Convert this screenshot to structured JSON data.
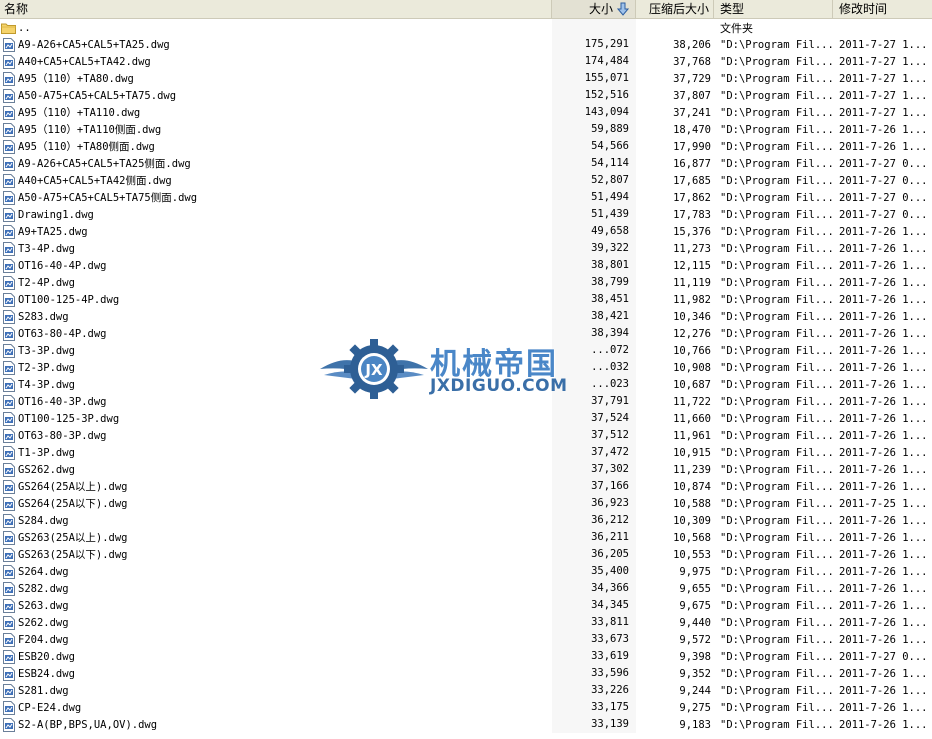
{
  "columns": {
    "name": "名称",
    "size": "大小",
    "compressed": "压缩后大小",
    "type": "类型",
    "modified": "修改时间"
  },
  "watermark": {
    "logo_letters": "JX",
    "cn": "机械帝国",
    "en": "JXDIGUO.COM"
  },
  "parent": {
    "name": "..",
    "type": "文件夹"
  },
  "files": [
    {
      "name": "A9-A26+CA5+CAL5+TA25.dwg",
      "size": "175,291",
      "comp": "38,206",
      "type": "\"D:\\Program Fil...",
      "time": "2011-7-27 1..."
    },
    {
      "name": "A40+CA5+CAL5+TA42.dwg",
      "size": "174,484",
      "comp": "37,768",
      "type": "\"D:\\Program Fil...",
      "time": "2011-7-27 1..."
    },
    {
      "name": "A95（110）+TA80.dwg",
      "size": "155,071",
      "comp": "37,729",
      "type": "\"D:\\Program Fil...",
      "time": "2011-7-27 1..."
    },
    {
      "name": "A50-A75+CA5+CAL5+TA75.dwg",
      "size": "152,516",
      "comp": "37,807",
      "type": "\"D:\\Program Fil...",
      "time": "2011-7-27 1..."
    },
    {
      "name": "A95（110）+TA110.dwg",
      "size": "143,094",
      "comp": "37,241",
      "type": "\"D:\\Program Fil...",
      "time": "2011-7-27 1..."
    },
    {
      "name": "A95（110）+TA110侧面.dwg",
      "size": "59,889",
      "comp": "18,470",
      "type": "\"D:\\Program Fil...",
      "time": "2011-7-26 1..."
    },
    {
      "name": "A95（110）+TA80侧面.dwg",
      "size": "54,566",
      "comp": "17,990",
      "type": "\"D:\\Program Fil...",
      "time": "2011-7-26 1..."
    },
    {
      "name": "A9-A26+CA5+CAL5+TA25侧面.dwg",
      "size": "54,114",
      "comp": "16,877",
      "type": "\"D:\\Program Fil...",
      "time": "2011-7-27 0..."
    },
    {
      "name": "A40+CA5+CAL5+TA42侧面.dwg",
      "size": "52,807",
      "comp": "17,685",
      "type": "\"D:\\Program Fil...",
      "time": "2011-7-27 0..."
    },
    {
      "name": "A50-A75+CA5+CAL5+TA75侧面.dwg",
      "size": "51,494",
      "comp": "17,862",
      "type": "\"D:\\Program Fil...",
      "time": "2011-7-27 0..."
    },
    {
      "name": "Drawing1.dwg",
      "size": "51,439",
      "comp": "17,783",
      "type": "\"D:\\Program Fil...",
      "time": "2011-7-27 0..."
    },
    {
      "name": "A9+TA25.dwg",
      "size": "49,658",
      "comp": "15,376",
      "type": "\"D:\\Program Fil...",
      "time": "2011-7-26 1..."
    },
    {
      "name": "T3-4P.dwg",
      "size": "39,322",
      "comp": "11,273",
      "type": "\"D:\\Program Fil...",
      "time": "2011-7-26 1..."
    },
    {
      "name": "OT16-40-4P.dwg",
      "size": "38,801",
      "comp": "12,115",
      "type": "\"D:\\Program Fil...",
      "time": "2011-7-26 1..."
    },
    {
      "name": "T2-4P.dwg",
      "size": "38,799",
      "comp": "11,119",
      "type": "\"D:\\Program Fil...",
      "time": "2011-7-26 1..."
    },
    {
      "name": "OT100-125-4P.dwg",
      "size": "38,451",
      "comp": "11,982",
      "type": "\"D:\\Program Fil...",
      "time": "2011-7-26 1..."
    },
    {
      "name": "S283.dwg",
      "size": "38,421",
      "comp": "10,346",
      "type": "\"D:\\Program Fil...",
      "time": "2011-7-26 1..."
    },
    {
      "name": "OT63-80-4P.dwg",
      "size": "38,394",
      "comp": "12,276",
      "type": "\"D:\\Program Fil...",
      "time": "2011-7-26 1..."
    },
    {
      "name": "T3-3P.dwg",
      "size": "...072",
      "comp": "10,766",
      "type": "\"D:\\Program Fil...",
      "time": "2011-7-26 1..."
    },
    {
      "name": "T2-3P.dwg",
      "size": "...032",
      "comp": "10,908",
      "type": "\"D:\\Program Fil...",
      "time": "2011-7-26 1..."
    },
    {
      "name": "T4-3P.dwg",
      "size": "...023",
      "comp": "10,687",
      "type": "\"D:\\Program Fil...",
      "time": "2011-7-26 1..."
    },
    {
      "name": "OT16-40-3P.dwg",
      "size": "37,791",
      "comp": "11,722",
      "type": "\"D:\\Program Fil...",
      "time": "2011-7-26 1..."
    },
    {
      "name": "OT100-125-3P.dwg",
      "size": "37,524",
      "comp": "11,660",
      "type": "\"D:\\Program Fil...",
      "time": "2011-7-26 1..."
    },
    {
      "name": "OT63-80-3P.dwg",
      "size": "37,512",
      "comp": "11,961",
      "type": "\"D:\\Program Fil...",
      "time": "2011-7-26 1..."
    },
    {
      "name": "T1-3P.dwg",
      "size": "37,472",
      "comp": "10,915",
      "type": "\"D:\\Program Fil...",
      "time": "2011-7-26 1..."
    },
    {
      "name": "GS262.dwg",
      "size": "37,302",
      "comp": "11,239",
      "type": "\"D:\\Program Fil...",
      "time": "2011-7-26 1..."
    },
    {
      "name": "GS264(25A以上).dwg",
      "size": "37,166",
      "comp": "10,874",
      "type": "\"D:\\Program Fil...",
      "time": "2011-7-26 1..."
    },
    {
      "name": "GS264(25A以下).dwg",
      "size": "36,923",
      "comp": "10,588",
      "type": "\"D:\\Program Fil...",
      "time": "2011-7-25 1..."
    },
    {
      "name": "S284.dwg",
      "size": "36,212",
      "comp": "10,309",
      "type": "\"D:\\Program Fil...",
      "time": "2011-7-26 1..."
    },
    {
      "name": "GS263(25A以上).dwg",
      "size": "36,211",
      "comp": "10,568",
      "type": "\"D:\\Program Fil...",
      "time": "2011-7-26 1..."
    },
    {
      "name": "GS263(25A以下).dwg",
      "size": "36,205",
      "comp": "10,553",
      "type": "\"D:\\Program Fil...",
      "time": "2011-7-26 1..."
    },
    {
      "name": "S264.dwg",
      "size": "35,400",
      "comp": "9,975",
      "type": "\"D:\\Program Fil...",
      "time": "2011-7-26 1..."
    },
    {
      "name": "S282.dwg",
      "size": "34,366",
      "comp": "9,655",
      "type": "\"D:\\Program Fil...",
      "time": "2011-7-26 1..."
    },
    {
      "name": "S263.dwg",
      "size": "34,345",
      "comp": "9,675",
      "type": "\"D:\\Program Fil...",
      "time": "2011-7-26 1..."
    },
    {
      "name": "S262.dwg",
      "size": "33,811",
      "comp": "9,440",
      "type": "\"D:\\Program Fil...",
      "time": "2011-7-26 1..."
    },
    {
      "name": "F204.dwg",
      "size": "33,673",
      "comp": "9,572",
      "type": "\"D:\\Program Fil...",
      "time": "2011-7-26 1..."
    },
    {
      "name": "ESB20.dwg",
      "size": "33,619",
      "comp": "9,398",
      "type": "\"D:\\Program Fil...",
      "time": "2011-7-27 0..."
    },
    {
      "name": "ESB24.dwg",
      "size": "33,596",
      "comp": "9,352",
      "type": "\"D:\\Program Fil...",
      "time": "2011-7-26 1..."
    },
    {
      "name": "S281.dwg",
      "size": "33,226",
      "comp": "9,244",
      "type": "\"D:\\Program Fil...",
      "time": "2011-7-26 1..."
    },
    {
      "name": "CP-E24.dwg",
      "size": "33,175",
      "comp": "9,275",
      "type": "\"D:\\Program Fil...",
      "time": "2011-7-26 1..."
    },
    {
      "name": "S2-A(BP,BPS,UA,OV).dwg",
      "size": "33,139",
      "comp": "9,183",
      "type": "\"D:\\Program Fil...",
      "time": "2011-7-26 1..."
    }
  ]
}
